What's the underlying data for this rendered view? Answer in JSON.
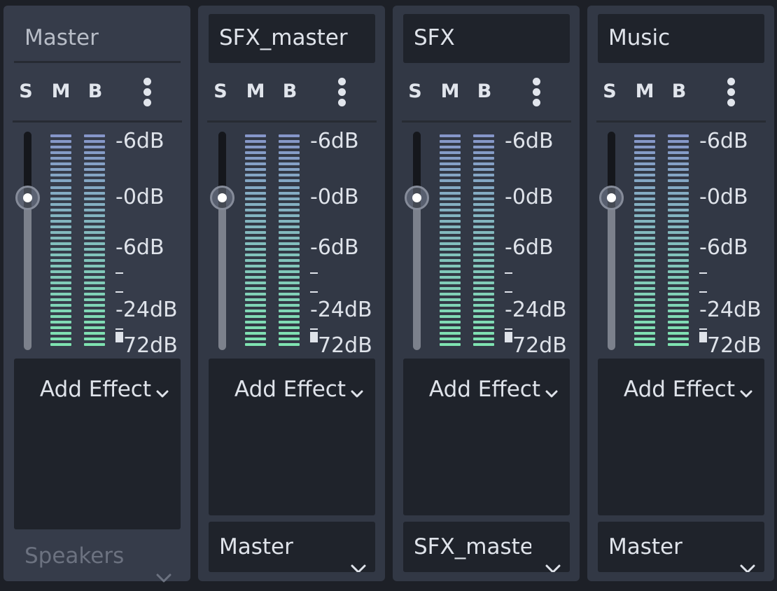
{
  "labels": {
    "solo": "S",
    "mute": "M",
    "bypass": "B",
    "add_effect": "Add Effect",
    "db_scale": [
      "-6dB",
      "-0dB",
      "-6dB",
      "-24dB",
      "-72dB"
    ]
  },
  "colors": {
    "background": "#1d2027",
    "panel": "#323845",
    "field": "#1f232b",
    "text": "#dfe3ea",
    "meter_top": "#8696c9",
    "meter_bottom": "#7fe3b1"
  },
  "icons": {
    "more": "vertical-ellipsis-icon",
    "dropdown": "chevron-down-icon"
  },
  "buses": [
    {
      "name": "Master",
      "output": "Speakers",
      "output_enabled": false,
      "volume_level": 0.65
    },
    {
      "name": "SFX_master",
      "output": "Master",
      "output_enabled": true,
      "volume_level": 0.65
    },
    {
      "name": "SFX",
      "output": "SFX_maste",
      "output_enabled": true,
      "volume_level": 0.65
    },
    {
      "name": "Music",
      "output": "Master",
      "output_enabled": true,
      "volume_level": 0.65
    }
  ]
}
